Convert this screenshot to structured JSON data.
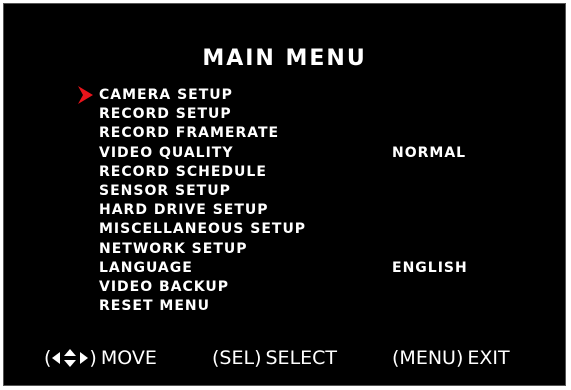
{
  "title": "MAIN MENU",
  "menu": {
    "selected_index": 0,
    "items": [
      {
        "label": "CAMERA SETUP",
        "value": ""
      },
      {
        "label": "RECORD SETUP",
        "value": ""
      },
      {
        "label": "RECORD FRAMERATE",
        "value": ""
      },
      {
        "label": "VIDEO QUALITY",
        "value": "NORMAL"
      },
      {
        "label": "RECORD SCHEDULE",
        "value": ""
      },
      {
        "label": "SENSOR SETUP",
        "value": ""
      },
      {
        "label": "HARD DRIVE SETUP",
        "value": ""
      },
      {
        "label": "MISCELLANEOUS SETUP",
        "value": ""
      },
      {
        "label": "NETWORK SETUP",
        "value": ""
      },
      {
        "label": "LANGUAGE",
        "value": "ENGLISH"
      },
      {
        "label": "VIDEO BACKUP",
        "value": ""
      },
      {
        "label": "RESET MENU",
        "value": ""
      }
    ]
  },
  "footer": {
    "move": {
      "key_icon": "direction-arrows-icon",
      "label": "MOVE"
    },
    "select": {
      "key": "SEL",
      "label": "SELECT"
    },
    "exit": {
      "key": "MENU",
      "label": "EXIT"
    }
  },
  "colors": {
    "background": "#000000",
    "text": "#ffffff",
    "cursor": "#e8141b"
  }
}
